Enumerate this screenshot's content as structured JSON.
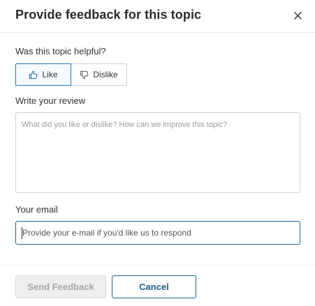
{
  "dialog": {
    "title": "Provide feedback for this topic",
    "close_glyph": "×"
  },
  "helpful": {
    "question": "Was this topic helpful?",
    "like_label": "Like",
    "dislike_label": "Dislike",
    "selected": "like"
  },
  "review": {
    "label": "Write your review",
    "placeholder": "What did you like or dislike? How can we improve this topic?",
    "value": ""
  },
  "email": {
    "label": "Your email",
    "placeholder": "Provide your e-mail if you'd like us to respond",
    "value": ""
  },
  "footer": {
    "send_label": "Send Feedback",
    "cancel_label": "Cancel"
  },
  "colors": {
    "accent": "#1d5f8a",
    "like_border": "#1f77b4",
    "disabled_text": "#a8a8a8"
  },
  "icons": {
    "close": "close-icon",
    "like": "thumbs-up-icon",
    "dislike": "thumbs-down-icon"
  }
}
